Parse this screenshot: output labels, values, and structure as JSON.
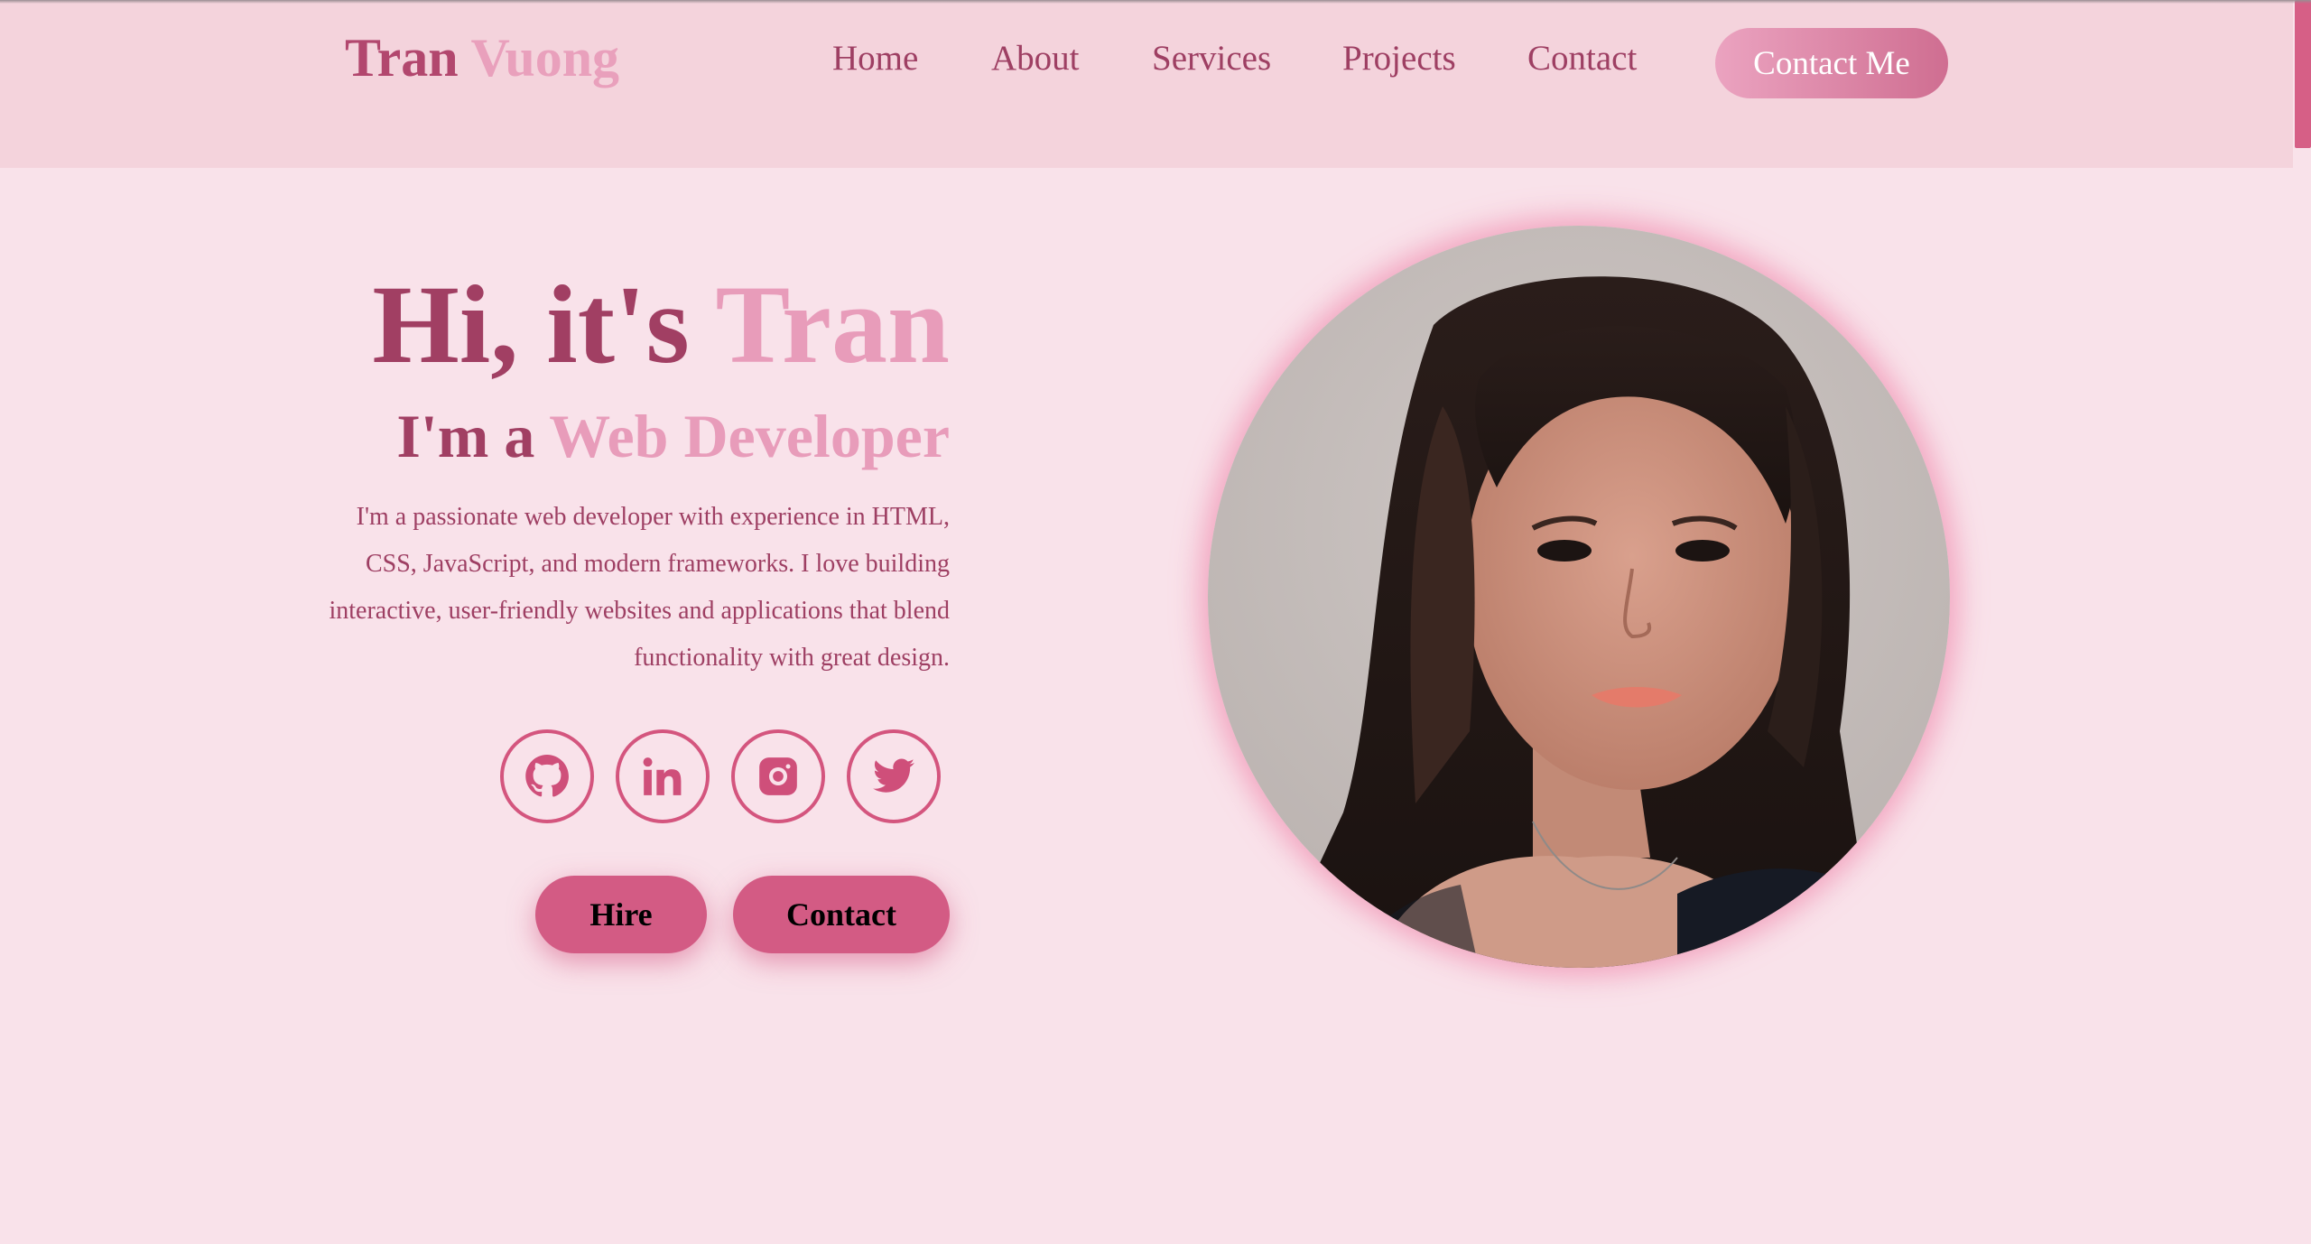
{
  "brand": {
    "first": "Tran",
    "last": "Vuong"
  },
  "nav": {
    "items": [
      "Home",
      "About",
      "Services",
      "Projects",
      "Contact"
    ],
    "cta_label": "Contact Me"
  },
  "hero": {
    "greeting": "Hi, it's ",
    "name": "Tran",
    "role_prefix": "I'm a ",
    "role": "Web Developer",
    "bio": "I'm a passionate web developer with experience in HTML, CSS, JavaScript, and modern frameworks. I love building interactive, user-friendly websites and applications that blend functionality with great design.",
    "buttons": {
      "hire": "Hire",
      "contact": "Contact"
    }
  },
  "socials": [
    "github-icon",
    "linkedin-icon",
    "instagram-icon",
    "twitter-icon"
  ],
  "colors": {
    "primary": "#a13f63",
    "accent": "#e89cba",
    "button": "#d35b84",
    "background": "#f9e2ea",
    "header": "#f4d3dc"
  }
}
